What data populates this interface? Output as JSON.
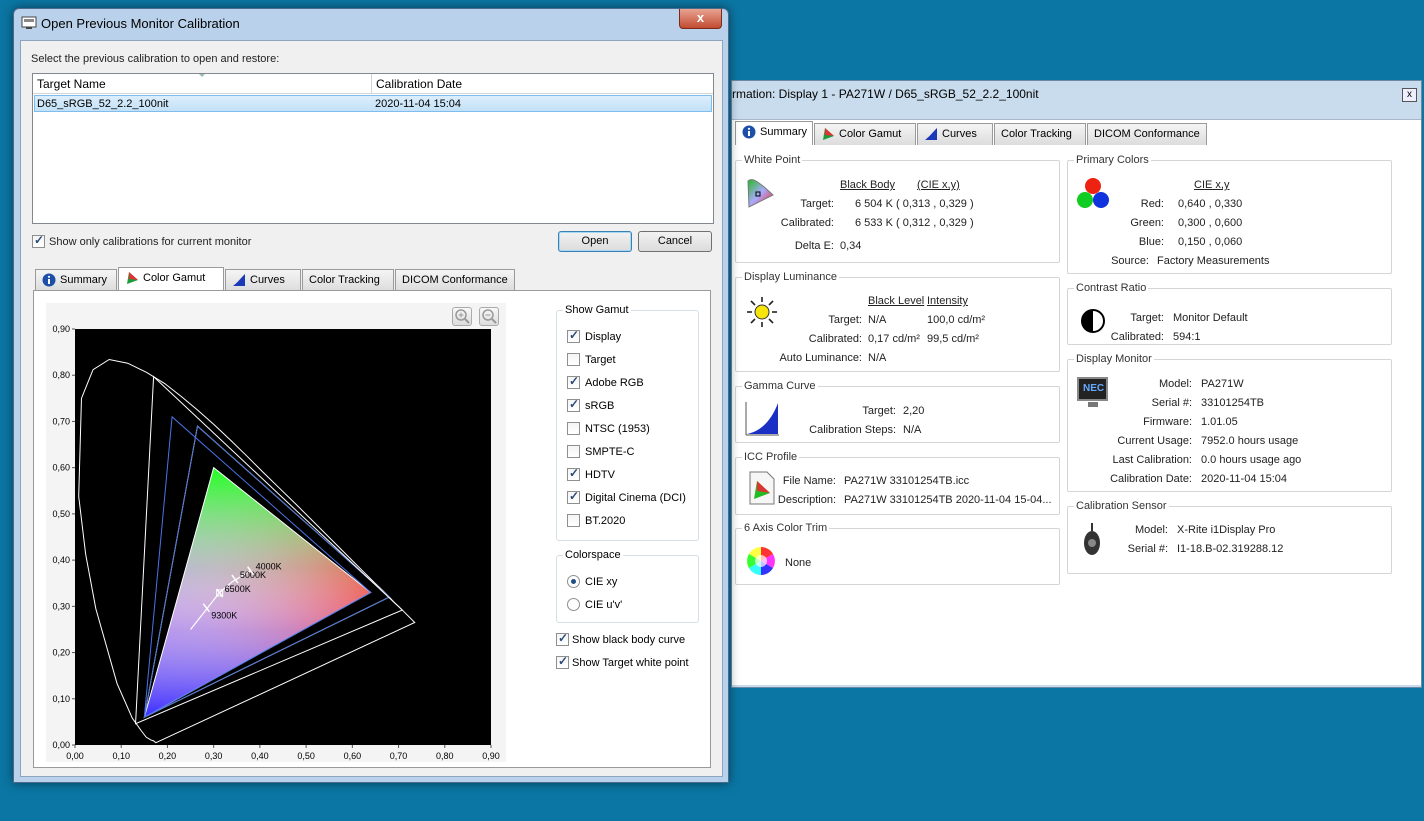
{
  "info_window": {
    "title": "rmation: Display 1 - PA271W / D65_sRGB_52_2.2_100nit",
    "close_label": "x",
    "tabs": [
      "Summary",
      "Color Gamut",
      "Curves",
      "Color Tracking",
      "DICOM Conformance"
    ],
    "white_point": {
      "title": "White Point",
      "col1": "Black Body",
      "col2": "(CIE x,y)",
      "target_label": "Target:",
      "target_value": "6 504 K  ( 0,313 , 0,329 )",
      "calibrated_label": "Calibrated:",
      "calibrated_value": "6 533 K  ( 0,312 , 0,329 )",
      "delta_label": "Delta E:",
      "delta_value": "0,34"
    },
    "luminance": {
      "title": "Display Luminance",
      "col1": "Black Level",
      "col2": "Intensity",
      "target_label": "Target:",
      "target_black": "N/A",
      "target_int": "100,0 cd/m²",
      "calibrated_label": "Calibrated:",
      "calibrated_black": "0,17 cd/m²",
      "calibrated_int": "99,5 cd/m²",
      "auto_label": "Auto Luminance:",
      "auto_value": "N/A"
    },
    "gamma": {
      "title": "Gamma Curve",
      "target_label": "Target:",
      "target_value": "2,20",
      "steps_label": "Calibration Steps:",
      "steps_value": "N/A"
    },
    "icc": {
      "title": "ICC Profile",
      "file_label": "File Name:",
      "file_value": "PA271W 33101254TB.icc",
      "desc_label": "Description:",
      "desc_value": "PA271W 33101254TB 2020-11-04 15-04..."
    },
    "color_trim": {
      "title": "6 Axis Color Trim",
      "value": "None"
    },
    "primaries": {
      "title": "Primary Colors",
      "col": "CIE x,y",
      "red_label": "Red:",
      "red_value": "0,640 , 0,330",
      "green_label": "Green:",
      "green_value": "0,300 , 0,600",
      "blue_label": "Blue:",
      "blue_value": "0,150 , 0,060",
      "source_label": "Source:",
      "source_value": "Factory Measurements"
    },
    "contrast": {
      "title": "Contrast Ratio",
      "target_label": "Target:",
      "target_value": "Monitor Default",
      "calibrated_label": "Calibrated:",
      "calibrated_value": "594:1"
    },
    "monitor": {
      "title": "Display Monitor",
      "logo": "NEC",
      "model_label": "Model:",
      "model_value": "PA271W",
      "serial_label": "Serial #:",
      "serial_value": "33101254TB",
      "firmware_label": "Firmware:",
      "firmware_value": "1.01.05",
      "usage_label": "Current Usage:",
      "usage_value": "7952.0 hours usage",
      "lastcal_label": "Last Calibration:",
      "lastcal_value": "0.0 hours usage ago",
      "caldate_label": "Calibration Date:",
      "caldate_value": "2020-11-04 15:04"
    },
    "sensor": {
      "title": "Calibration Sensor",
      "model_label": "Model:",
      "model_value": "X-Rite i1Display Pro",
      "serial_label": "Serial #:",
      "serial_value": "I1-18.B-02.319288.12"
    }
  },
  "dialog": {
    "title": "Open Previous Monitor Calibration",
    "close_label": "x",
    "instruction": "Select the previous calibration to open and restore:",
    "columns": [
      "Target Name",
      "Calibration Date"
    ],
    "rows": [
      {
        "name": "D65_sRGB_52_2.2_100nit",
        "date": "2020-11-04 15:04"
      }
    ],
    "show_only_label": "Show only calibrations for current monitor",
    "open_label": "Open",
    "cancel_label": "Cancel",
    "tabs": [
      "Summary",
      "Color Gamut",
      "Curves",
      "Color Tracking",
      "DICOM Conformance"
    ],
    "show_gamut": {
      "title": "Show Gamut",
      "items": [
        {
          "label": "Display",
          "checked": true
        },
        {
          "label": "Target",
          "checked": false
        },
        {
          "label": "Adobe RGB",
          "checked": true
        },
        {
          "label": "sRGB",
          "checked": true
        },
        {
          "label": "NTSC (1953)",
          "checked": false
        },
        {
          "label": "SMPTE-C",
          "checked": false
        },
        {
          "label": "HDTV",
          "checked": true
        },
        {
          "label": "Digital Cinema (DCI)",
          "checked": true
        },
        {
          "label": "BT.2020",
          "checked": false
        }
      ]
    },
    "colorspace": {
      "title": "Colorspace",
      "options": [
        {
          "label": "CIE xy",
          "selected": true
        },
        {
          "label": "CIE u'v'",
          "selected": false
        }
      ]
    },
    "black_body_label": "Show black body curve",
    "target_white_label": "Show Target white point"
  },
  "chart_data": {
    "type": "scatter",
    "title": "",
    "xlabel": "",
    "ylabel": "",
    "xlim": [
      0,
      0.9
    ],
    "ylim": [
      0,
      0.9
    ],
    "xticks": [
      "0,00",
      "0,10",
      "0,20",
      "0,30",
      "0,40",
      "0,50",
      "0,60",
      "0,70",
      "0,80",
      "0,90"
    ],
    "yticks": [
      "0,00",
      "0,10",
      "0,20",
      "0,30",
      "0,40",
      "0,50",
      "0,60",
      "0,70",
      "0,80",
      "0,90"
    ],
    "background": "#000000",
    "series": [
      {
        "color": "#ffffff",
        "points": [
          [
            0.64,
            0.33
          ],
          [
            0.3,
            0.6
          ],
          [
            0.15,
            0.06
          ]
        ]
      },
      {
        "color": "#ffff66",
        "points": [
          [
            0.68,
            0.32
          ],
          [
            0.265,
            0.69
          ],
          [
            0.15,
            0.06
          ]
        ]
      },
      {
        "color": "#4a73e8",
        "points": [
          [
            0.64,
            0.33
          ],
          [
            0.21,
            0.71
          ],
          [
            0.15,
            0.06
          ]
        ]
      },
      {
        "color": "#4a73e8",
        "points": [
          [
            0.68,
            0.32
          ],
          [
            0.265,
            0.69
          ],
          [
            0.15,
            0.06
          ]
        ]
      },
      {
        "color": "#ffffff",
        "points": [
          [
            0.708,
            0.292
          ],
          [
            0.17,
            0.797
          ],
          [
            0.131,
            0.046
          ]
        ]
      }
    ],
    "spectral_locus": [
      [
        0.175,
        0.005
      ],
      [
        0.17,
        0.009
      ],
      [
        0.164,
        0.011
      ],
      [
        0.154,
        0.017
      ],
      [
        0.144,
        0.03
      ],
      [
        0.124,
        0.058
      ],
      [
        0.091,
        0.133
      ],
      [
        0.045,
        0.295
      ],
      [
        0.023,
        0.413
      ],
      [
        0.008,
        0.538
      ],
      [
        0.014,
        0.75
      ],
      [
        0.039,
        0.812
      ],
      [
        0.074,
        0.834
      ],
      [
        0.114,
        0.826
      ],
      [
        0.155,
        0.806
      ],
      [
        0.194,
        0.782
      ],
      [
        0.23,
        0.754
      ],
      [
        0.266,
        0.724
      ],
      [
        0.302,
        0.692
      ],
      [
        0.337,
        0.659
      ],
      [
        0.373,
        0.624
      ],
      [
        0.408,
        0.589
      ],
      [
        0.444,
        0.554
      ],
      [
        0.479,
        0.52
      ],
      [
        0.512,
        0.487
      ],
      [
        0.545,
        0.454
      ],
      [
        0.575,
        0.424
      ],
      [
        0.603,
        0.396
      ],
      [
        0.627,
        0.372
      ],
      [
        0.648,
        0.351
      ],
      [
        0.666,
        0.334
      ],
      [
        0.68,
        0.32
      ],
      [
        0.691,
        0.308
      ],
      [
        0.7,
        0.3
      ],
      [
        0.735,
        0.265
      ]
    ],
    "black_body": [
      [
        0.25,
        0.25
      ],
      [
        0.28,
        0.288
      ],
      [
        0.312,
        0.329
      ],
      [
        0.34,
        0.353
      ],
      [
        0.38,
        0.377
      ]
    ],
    "black_body_labels": [
      {
        "label": "9300K",
        "x": 0.284,
        "y": 0.297
      },
      {
        "label": "6500K",
        "x": 0.313,
        "y": 0.329
      },
      {
        "label": "5000K",
        "x": 0.346,
        "y": 0.359
      },
      {
        "label": "4000K",
        "x": 0.38,
        "y": 0.377
      }
    ]
  }
}
